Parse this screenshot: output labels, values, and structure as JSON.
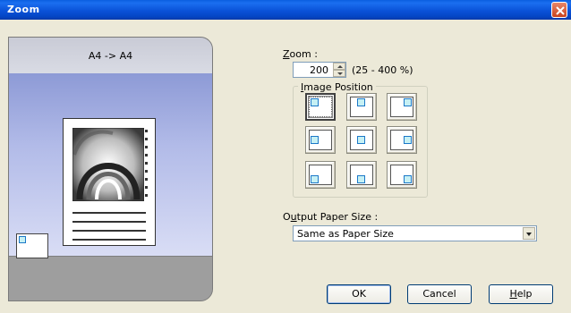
{
  "window": {
    "title": "Zoom"
  },
  "preview": {
    "paper_label": "A4 -> A4"
  },
  "zoom": {
    "label_prefix": "Z",
    "label_underline": "",
    "label_rest": "oom :",
    "value": "200",
    "range_text": "(25 - 400 %)"
  },
  "image_position": {
    "label_prefix": "",
    "label_underline": "I",
    "label_rest": "mage Position",
    "selected": "top-left",
    "options": [
      "top-left",
      "top-center",
      "top-right",
      "middle-left",
      "center",
      "middle-right",
      "bottom-left",
      "bottom-center",
      "bottom-right"
    ]
  },
  "output_paper_size": {
    "label_prefix": "O",
    "label_underline": "u",
    "label_rest": "tput Paper Size :",
    "selected": "Same as Paper Size"
  },
  "buttons": {
    "ok": "OK",
    "cancel": "Cancel",
    "help_underline": "H",
    "help_rest": "elp"
  },
  "icons": {
    "close": "close-icon",
    "spin": "spinner-arrows-icon",
    "dropdown": "chevron-down-icon"
  },
  "colors": {
    "titlebar": "#0a52d8",
    "close": "#d65a34",
    "preview_blue": "#b2bbe8",
    "marker": "#1b78c8"
  }
}
